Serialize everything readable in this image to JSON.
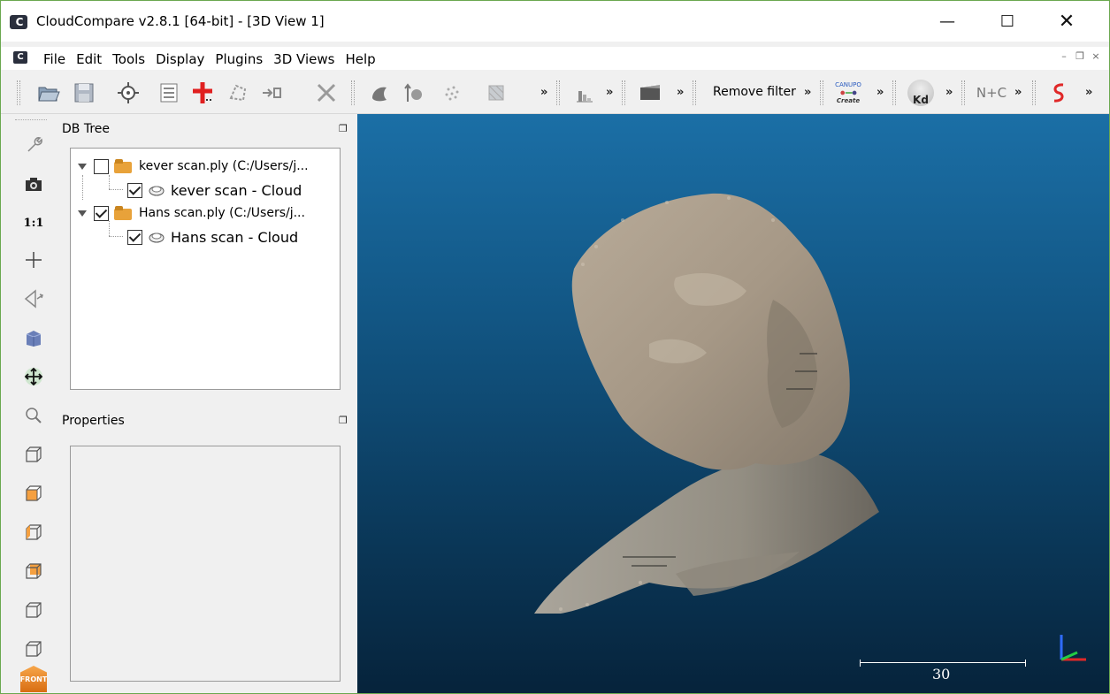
{
  "window": {
    "title": "CloudCompare v2.8.1 [64-bit] - [3D View 1]",
    "app_icon_text": "C",
    "minimize_glyph": "—",
    "maximize_glyph": "☐",
    "close_glyph": "✕"
  },
  "menu": {
    "logo_text": "C",
    "items": [
      "File",
      "Edit",
      "Tools",
      "Display",
      "Plugins",
      "3D Views",
      "Help"
    ],
    "mdi_minimize": "–",
    "mdi_restore": "❐",
    "mdi_close": "×"
  },
  "toolbar": {
    "more_glyph": "»",
    "remove_filter_label": "Remove filter",
    "canupo_label": "CANUPO",
    "canupo_sub": "Create",
    "kd_label": "Kd",
    "nc_label": "N+C"
  },
  "left_toolbar": {
    "ratio_label": "1:1",
    "front_label": "FRONT"
  },
  "db_tree": {
    "title": "DB Tree",
    "float_glyph": "❐",
    "nodes": [
      {
        "label": "kever scan.ply (C:/Users/j...",
        "checked": false
      },
      {
        "label": "kever scan - Cloud",
        "checked": true
      },
      {
        "label": "Hans scan.ply (C:/Users/j...",
        "checked": true
      },
      {
        "label": "Hans scan - Cloud",
        "checked": true
      }
    ]
  },
  "properties": {
    "title": "Properties",
    "float_glyph": "❐"
  },
  "view3d": {
    "scale_value": "30",
    "background_top": "#1b6fa6",
    "background_bottom": "#06233b"
  }
}
